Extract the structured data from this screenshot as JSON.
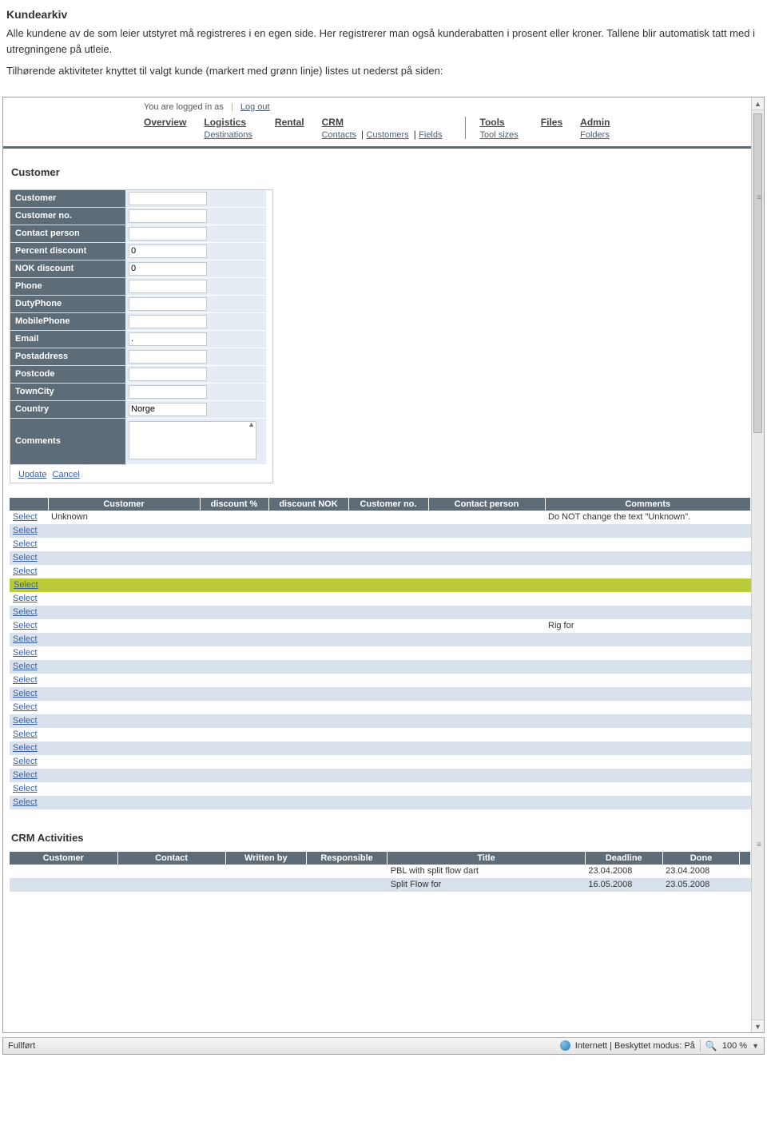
{
  "doc": {
    "title": "Kundearkiv",
    "p1": "Alle kundene av de som leier utstyret må registreres i en egen side. Her registrerer man også kunderabatten i prosent eller kroner. Tallene blir automatisk tatt med i utregningene på utleie.",
    "p2": "Tilhørende aktiviteter knyttet til valgt kunde (markert med grønn linje) listes ut nederst på siden:"
  },
  "header": {
    "logged_in_as": "You are logged in as",
    "logout": "Log out"
  },
  "nav": {
    "overview": "Overview",
    "logistics": "Logistics",
    "logistics_sub": "Destinations",
    "rental": "Rental",
    "crm": "CRM",
    "crm_sub": [
      "Contacts",
      "Customers",
      "Fields"
    ],
    "tools": "Tools",
    "tools_sub": "Tool sizes",
    "files": "Files",
    "admin": "Admin",
    "admin_sub": "Folders"
  },
  "section_customer": "Customer",
  "form": {
    "customer": "Customer",
    "customer_no": "Customer no.",
    "contact_person": "Contact person",
    "percent_discount": "Percent discount",
    "percent_discount_val": "0",
    "nok_discount": "NOK discount",
    "nok_discount_val": "0",
    "phone": "Phone",
    "dutyphone": "DutyPhone",
    "mobilephone": "MobilePhone",
    "email": "Email",
    "email_val": ".",
    "postaddress": "Postaddress",
    "postcode": "Postcode",
    "towncity": "TownCity",
    "country": "Country",
    "country_val": "Norge",
    "comments": "Comments",
    "update": "Update",
    "cancel": "Cancel"
  },
  "list": {
    "headers": {
      "blank": "",
      "customer": "Customer",
      "discount_pct": "discount %",
      "discount_nok": "discount NOK",
      "customer_no": "Customer no.",
      "contact_person": "Contact person",
      "comments": "Comments"
    },
    "select": "Select",
    "rows": [
      {
        "customer": "Unknown",
        "comments": "Do NOT change the text \"Unknown\"."
      },
      {},
      {},
      {},
      {},
      {
        "highlight": true
      },
      {},
      {},
      {
        "comments": "Rig for"
      },
      {},
      {},
      {},
      {},
      {},
      {},
      {},
      {},
      {},
      {},
      {},
      {},
      {}
    ]
  },
  "crm": {
    "title": "CRM Activities",
    "headers": {
      "customer": "Customer",
      "contact": "Contact",
      "written_by": "Written by",
      "responsible": "Responsible",
      "title": "Title",
      "deadline": "Deadline",
      "done": "Done"
    },
    "rows": [
      {
        "title": "PBL with split flow dart",
        "deadline": "23.04.2008",
        "done": "23.04.2008"
      },
      {
        "title": "Split Flow for",
        "deadline": "16.05.2008",
        "done": "23.05.2008"
      }
    ]
  },
  "status": {
    "left": "Fullført",
    "mode": "Internett | Beskyttet modus: På",
    "zoom": "100 %"
  }
}
